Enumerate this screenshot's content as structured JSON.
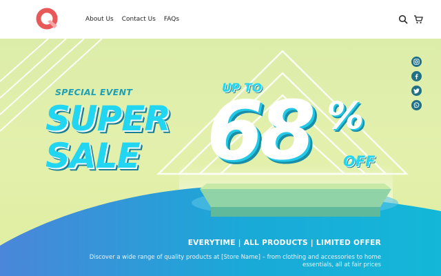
{
  "brand": {
    "logo_icon": "q-logo-icon",
    "color": "#e85a5a"
  },
  "nav": {
    "items": [
      {
        "label": "About Us"
      },
      {
        "label": "Contact Us"
      },
      {
        "label": "FAQs"
      }
    ]
  },
  "header_icons": [
    "search-icon",
    "cart-icon"
  ],
  "hero": {
    "eyebrow": "SPECIAL EVENT",
    "line1": "SUPER",
    "line2": "SALE",
    "upto": "UP TO",
    "discount": "68",
    "percent_sign": "%",
    "off": "OFF",
    "tagline": "EVERYTIME | ALL PRODUCTS | LIMITED OFFER",
    "description": "Discover a wide range of quality products at [Store Name] – from clothing and accessories to home essentials, all at fair prices",
    "colors": {
      "accent": "#22d6f2",
      "shadow": "#1b7f93",
      "background": "#dfee9f",
      "wave": "#1aa9d8"
    }
  },
  "social": [
    "instagram-icon",
    "facebook-icon",
    "twitter-icon",
    "whatsapp-icon"
  ]
}
